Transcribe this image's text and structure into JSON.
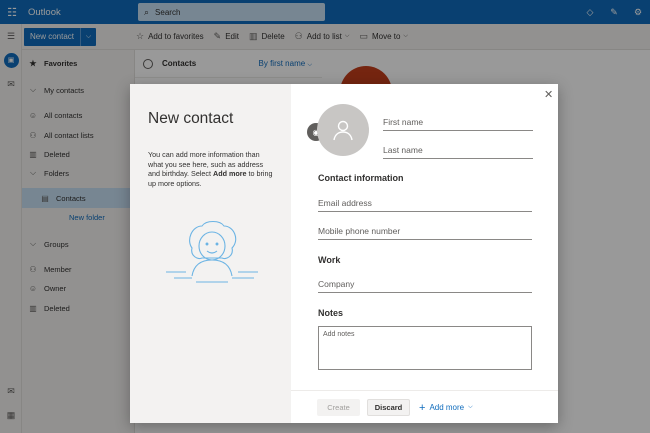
{
  "topbar": {
    "app_name": "Outlook",
    "search_placeholder": "Search",
    "icons": [
      "waffle-icon",
      "diamond-icon",
      "compose-icon",
      "settings-icon"
    ]
  },
  "rail": {
    "icons": [
      "mail-icon",
      "people-icon",
      "mail-bottom-icon",
      "calendar-icon"
    ]
  },
  "commandbar": {
    "new_contact": "New contact",
    "add_to_favorites": "Add to favorites",
    "edit": "Edit",
    "delete": "Delete",
    "add_to_list": "Add to list",
    "move_to": "Move to"
  },
  "nav": {
    "favorites": "Favorites",
    "my_contacts": "My contacts",
    "all_contacts": "All contacts",
    "all_contact_lists": "All contact lists",
    "deleted": "Deleted",
    "folders": "Folders",
    "contacts": "Contacts",
    "new_folder": "New folder",
    "groups": "Groups",
    "member": "Member",
    "owner": "Owner",
    "groups_deleted": "Deleted"
  },
  "list": {
    "title": "Contacts",
    "sort": "By first name"
  },
  "dialog": {
    "title": "New contact",
    "info_before": "You can add more information than what you see here, such as address and birthday. Select ",
    "info_bold": "Add more",
    "info_after": " to bring up more options.",
    "first_name": "First name",
    "last_name": "Last name",
    "contact_info_title": "Contact information",
    "email_placeholder": "Email address",
    "phone_placeholder": "Mobile phone number",
    "work_title": "Work",
    "company_placeholder": "Company",
    "notes_title": "Notes",
    "notes_placeholder": "Add notes",
    "create": "Create",
    "discard": "Discard",
    "add_more": "Add more"
  }
}
